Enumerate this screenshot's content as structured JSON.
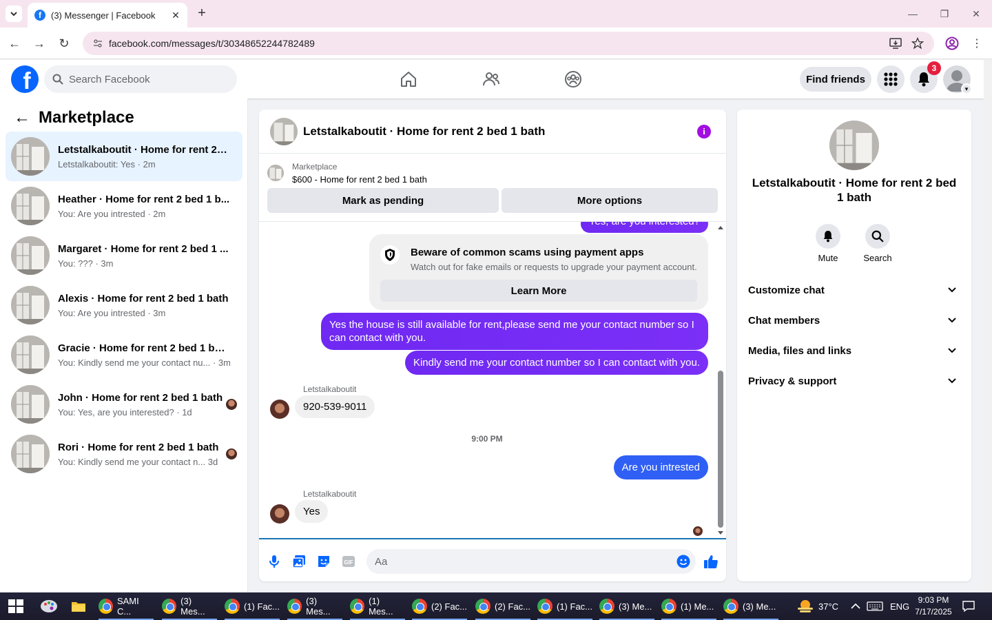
{
  "browser": {
    "tab_title": "(3) Messenger | Facebook",
    "url": "facebook.com/messages/t/30348652244782489"
  },
  "fb": {
    "logo": "f",
    "search_placeholder": "Search Facebook",
    "find_friends": "Find friends",
    "notification_count": "3"
  },
  "sidebar": {
    "title": "Marketplace",
    "conversations": [
      {
        "name": "Letstalkaboutit · Home for rent 2 b...",
        "preview": "Letstalkaboutit: Yes · 2m"
      },
      {
        "name": "Heather · Home for rent 2 bed 1 b...",
        "preview": "You: Are you intrested · 2m"
      },
      {
        "name": "Margaret · Home for rent 2 bed 1 ...",
        "preview": "You: ??? · 3m"
      },
      {
        "name": "Alexis · Home for rent 2 bed 1 bath",
        "preview": "You: Are you intrested · 3m"
      },
      {
        "name": "Gracie · Home for rent 2 bed 1 bath",
        "preview": "You: Kindly send me your contact nu...  · 3m"
      },
      {
        "name": "John · Home for rent 2 bed 1 bath",
        "preview": "You: Yes, are you interested? · 1d"
      },
      {
        "name": "Rori · Home for rent 2 bed 1 bath",
        "preview": "You: Kindly send me your contact n... 3d"
      }
    ]
  },
  "chat": {
    "title": "Letstalkaboutit · Home for rent 2 bed 1 bath",
    "marketplace_label": "Marketplace",
    "listing": "$600 - Home for rent 2 bed 1 bath",
    "mark_pending": "Mark as pending",
    "more_options": "More options",
    "partial_top": "Yes, are you interested?",
    "scam_heading": "Beware of common scams using payment apps",
    "scam_desc": "Watch out for fake emails or requests to upgrade your payment account.",
    "learn_more": "Learn More",
    "msg_out_1": "Yes the house is still available for rent,please send me your contact number so I can contact with you.",
    "msg_out_2": "Kindly send me your contact number so I can contact with you.",
    "sender_1": "Letstalkaboutit",
    "msg_in_1": "920-539-9011",
    "time": "9:00 PM",
    "msg_out_3": "Are you intrested",
    "sender_2": "Letstalkaboutit",
    "msg_in_2": "Yes",
    "composer_placeholder": "Aa"
  },
  "info": {
    "name": "Letstalkaboutit · Home for rent 2 bed 1 bath",
    "mute": "Mute",
    "search": "Search",
    "sections": [
      "Customize chat",
      "Chat members",
      "Media, files and links",
      "Privacy & support"
    ]
  },
  "taskbar": {
    "apps": [
      "SAMI C...",
      "(3) Mes...",
      "(1) Fac...",
      "(3) Mes...",
      "(1) Mes...",
      "(2) Fac...",
      "(2) Fac...",
      "(1) Fac...",
      "(3) Me...",
      "(1) Me...",
      "(3) Me..."
    ],
    "temp": "37°C",
    "lang": "ENG",
    "time": "9:03 PM",
    "date": "7/17/2025"
  },
  "colors": {
    "fb_blue": "#0866ff",
    "outgoing_purple": "#7b2ff7",
    "outgoing_blue": "#2f5ff4",
    "info_purple": "#a30ee3",
    "badge_red": "#e41e3f"
  }
}
